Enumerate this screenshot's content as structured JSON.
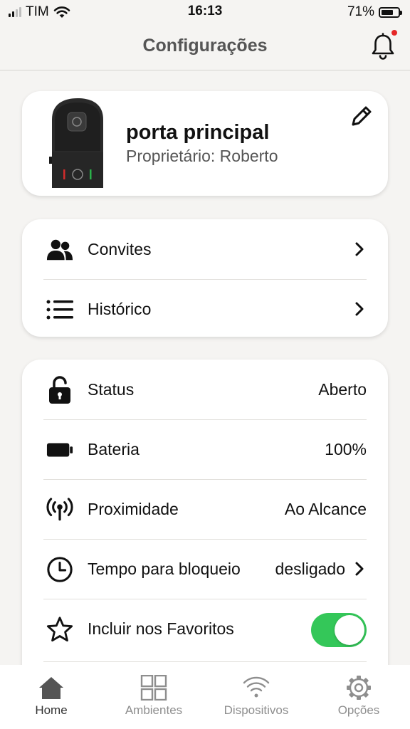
{
  "status_bar": {
    "carrier": "TIM",
    "time": "16:13",
    "battery_percent": "71%",
    "battery_level": 0.71
  },
  "header": {
    "title": "Configurações",
    "notification_dot_color": "#e52727",
    "bell_icon": "bell-icon"
  },
  "device": {
    "name": "porta principal",
    "owner": "Proprietário: Roberto",
    "edit_icon": "pencil-icon"
  },
  "nav_items": [
    {
      "label": "Convites",
      "icon": "users-icon"
    },
    {
      "label": "Histórico",
      "icon": "list-icon"
    }
  ],
  "settings": {
    "status": {
      "label": "Status",
      "value": "Aberto",
      "icon": "unlocked-padlock-icon"
    },
    "battery": {
      "label": "Bateria",
      "value": "100%",
      "icon": "battery-icon"
    },
    "proximity": {
      "label": "Proximidade",
      "value": "Ao Alcance",
      "icon": "broadcast-icon"
    },
    "lock_time": {
      "label": "Tempo para bloqueio",
      "value": "desligado",
      "icon": "clock-icon"
    },
    "favorites": {
      "label": "Incluir nos Favoritos",
      "enabled": true,
      "icon": "star-icon",
      "toggle_color": "#34c759"
    }
  },
  "tabs": [
    {
      "label": "Home",
      "icon": "home-icon",
      "active": true
    },
    {
      "label": "Ambientes",
      "icon": "grid-icon",
      "active": false
    },
    {
      "label": "Dispositivos",
      "icon": "wifi-icon",
      "active": false
    },
    {
      "label": "Opções",
      "icon": "gear-icon",
      "active": false
    }
  ]
}
